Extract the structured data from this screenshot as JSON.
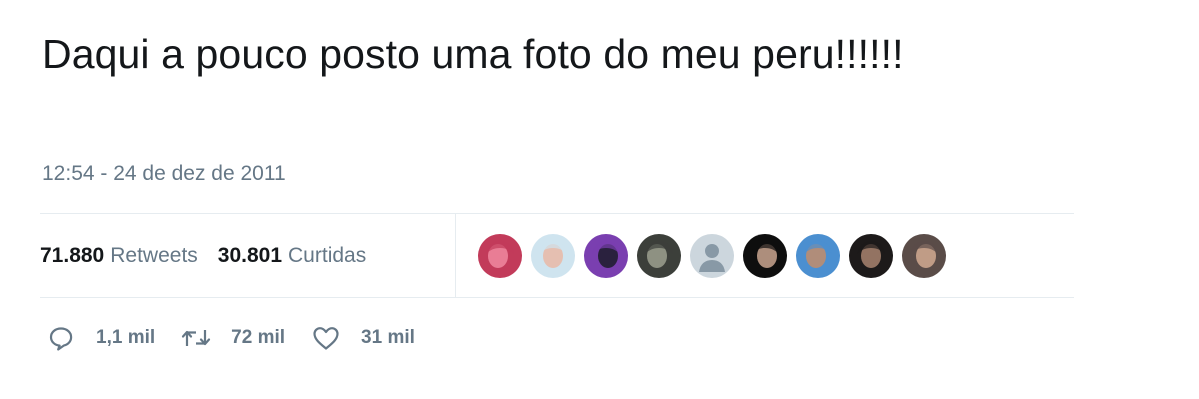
{
  "tweet": {
    "text": "Daqui a pouco posto uma foto do meu peru!!!!!!",
    "timestamp": "12:54 - 24 de dez de 2011"
  },
  "stats": {
    "retweets_count": "71.880",
    "retweets_label": "Retweets",
    "likes_count": "30.801",
    "likes_label": "Curtidas"
  },
  "avatars": [
    {
      "icon": "user-avatar-photo",
      "colors": [
        "#c23b5a",
        "#f08aa0"
      ]
    },
    {
      "icon": "user-avatar-photo",
      "colors": [
        "#cfe4ef",
        "#e9b9a6"
      ]
    },
    {
      "icon": "user-avatar-photo",
      "colors": [
        "#7a3fb0",
        "#1c1c2a"
      ]
    },
    {
      "icon": "user-avatar-photo",
      "colors": [
        "#3c3f3a",
        "#9ca08f"
      ]
    },
    {
      "icon": "default-profile-icon",
      "colors": [
        "#ccd6dd",
        "#8899a6"
      ]
    },
    {
      "icon": "user-avatar-photo",
      "colors": [
        "#0e0e0e",
        "#c9a58f"
      ]
    },
    {
      "icon": "user-avatar-photo",
      "colors": [
        "#4b8fd0",
        "#c28d6b"
      ]
    },
    {
      "icon": "user-avatar-photo",
      "colors": [
        "#1d1a1a",
        "#a88470"
      ]
    },
    {
      "icon": "user-avatar-photo",
      "colors": [
        "#5a4c48",
        "#d2aa92"
      ]
    }
  ],
  "actions": {
    "reply_count": "1,1 mil",
    "retweet_count": "72 mil",
    "like_count": "31 mil"
  },
  "colors": {
    "text": "#14171a",
    "muted": "#657786",
    "divider": "#e6ecf0"
  }
}
